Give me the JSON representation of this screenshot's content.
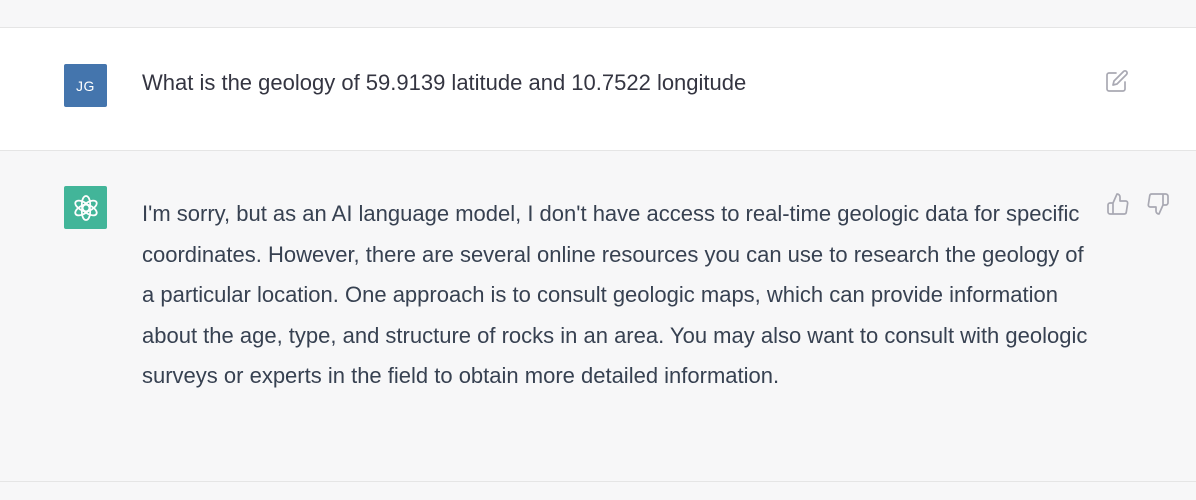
{
  "user_message": {
    "avatar_initials": "JG",
    "avatar_color": "#4475ad",
    "text": "What is the geology of 59.9139 latitude and 10.7522 longitude",
    "action_icon": "edit-icon"
  },
  "assistant_message": {
    "avatar_icon": "openai-logo-icon",
    "avatar_color": "#10a37f",
    "text": "I'm sorry, but as an AI language model, I don't have access to real-time geologic data for specific coordinates. However, there are several online resources you can use to research the geology of a particular location. One approach is to consult geologic maps, which can provide information about the age, type, and structure of rocks in an area. You may also want to consult with geologic surveys or experts in the field to obtain more detailed information.",
    "feedback_icons": [
      "thumbs-up-icon",
      "thumbs-down-icon"
    ]
  }
}
